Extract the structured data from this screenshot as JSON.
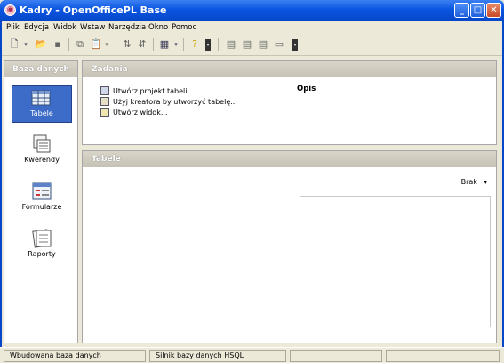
{
  "window": {
    "title": "Kadry - OpenOfficePL Base",
    "app_icon": "openoffice-icon"
  },
  "window_buttons": {
    "minimize": "_",
    "maximize": "□",
    "close": "✕"
  },
  "menu": [
    {
      "label": "Plik"
    },
    {
      "label": "Edycja"
    },
    {
      "label": "Widok"
    },
    {
      "label": "Wstaw"
    },
    {
      "label": "Narzędzia"
    },
    {
      "label": "Okno"
    },
    {
      "label": "Pomoc"
    }
  ],
  "left_panel": {
    "title": "Baza danych",
    "items": [
      {
        "label": "Tabele",
        "icon": "table-icon",
        "selected": true
      },
      {
        "label": "Kwerendy",
        "icon": "query-icon",
        "selected": false
      },
      {
        "label": "Formularze",
        "icon": "form-icon",
        "selected": false
      },
      {
        "label": "Raporty",
        "icon": "report-icon",
        "selected": false
      }
    ]
  },
  "tasks_panel": {
    "title": "Zadania",
    "tasks": [
      {
        "label": "Utwórz projekt tabeli..."
      },
      {
        "label": "Użyj kreatora by utworzyć tabelę..."
      },
      {
        "label": "Utwórz widok..."
      }
    ],
    "description_title": "Opis"
  },
  "tables_panel": {
    "title": "Tabele",
    "preview_mode": "Brak"
  },
  "statusbar": {
    "field1": "Wbudowana baza danych",
    "field2": "Silnik bazy danych HSQL",
    "field3": "",
    "field4": ""
  },
  "colors": {
    "titlebar": "#0a55e0",
    "selection": "#3d6bc8",
    "panel_header": "#c5c1b5"
  }
}
